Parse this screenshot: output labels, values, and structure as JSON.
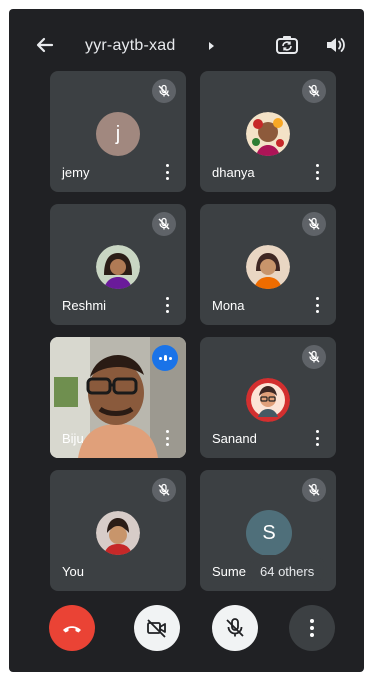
{
  "header": {
    "meeting_code": "yyr-aytb-xad",
    "icons": [
      "back-arrow-icon",
      "chevron-right-icon",
      "switch-camera-icon",
      "speaker-icon"
    ]
  },
  "participants": [
    {
      "name": "jemy",
      "avatar_initial": "j",
      "avatar_color": "#a1887f",
      "muted": true
    },
    {
      "name": "dhanya",
      "avatar_color": "#8d5a3b",
      "muted": true
    },
    {
      "name": "Reshmi",
      "avatar_color": "#6d4c41",
      "muted": true
    },
    {
      "name": "Mona",
      "avatar_color": "#c8a27c",
      "muted": true
    },
    {
      "name": "Biju",
      "speaking": true,
      "video_on": true
    },
    {
      "name": "Sanand",
      "avatar_color": "#d32f2f",
      "muted": true
    },
    {
      "name": "You",
      "avatar_color": "#5d4037",
      "muted": true
    },
    {
      "name": "Sume",
      "avatar_initial": "S",
      "avatar_color": "#4f6f7a",
      "muted": true
    }
  ],
  "others_chip": "64 others",
  "controls": {
    "end_call_color": "#ea4335",
    "icons": [
      "end-call-icon",
      "camera-off-icon",
      "mic-off-icon",
      "more-options-icon"
    ]
  },
  "colors": {
    "background": "#202124",
    "tile": "#3c4043",
    "speaking": "#1a73e8"
  }
}
